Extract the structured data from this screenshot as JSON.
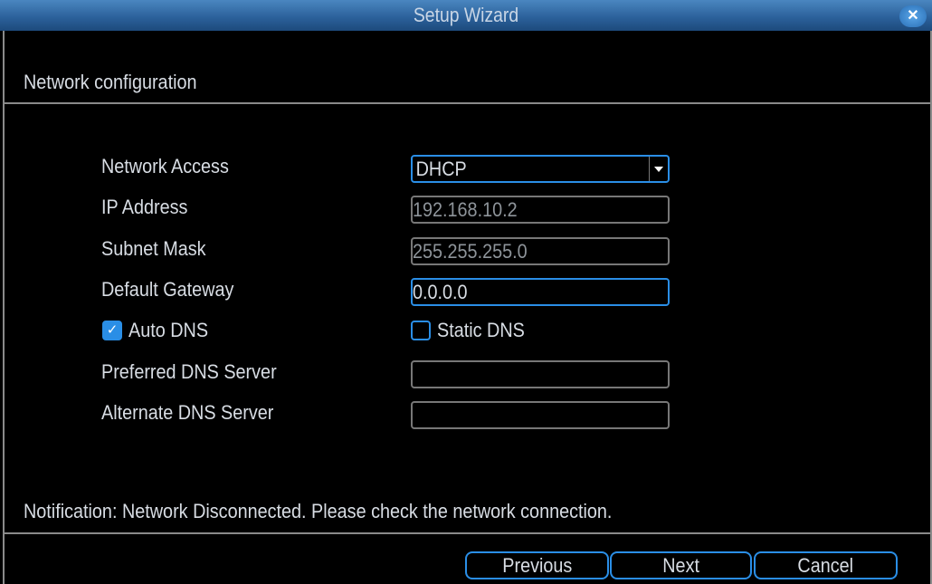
{
  "window": {
    "title": "Setup Wizard",
    "close_icon": "close-icon"
  },
  "section": {
    "title": "Network configuration"
  },
  "form": {
    "network_access": {
      "label": "Network Access",
      "value": "DHCP"
    },
    "ip_address": {
      "label": "IP Address",
      "value": "192.168.10.2"
    },
    "subnet_mask": {
      "label": "Subnet Mask",
      "value": "255.255.255.0"
    },
    "default_gateway": {
      "label": "Default Gateway",
      "value": "0.0.0.0"
    },
    "auto_dns": {
      "label": "Auto DNS",
      "checked": true
    },
    "static_dns": {
      "label": "Static DNS",
      "checked": false
    },
    "preferred_dns": {
      "label": "Preferred DNS Server",
      "value": ""
    },
    "alternate_dns": {
      "label": "Alternate DNS Server",
      "value": ""
    }
  },
  "notification": "Notification: Network Disconnected. Please check the network connection.",
  "buttons": {
    "previous": "Previous",
    "next": "Next",
    "cancel": "Cancel"
  },
  "colors": {
    "accent": "#2a8ee6",
    "titlebar": "#2a5f98"
  }
}
